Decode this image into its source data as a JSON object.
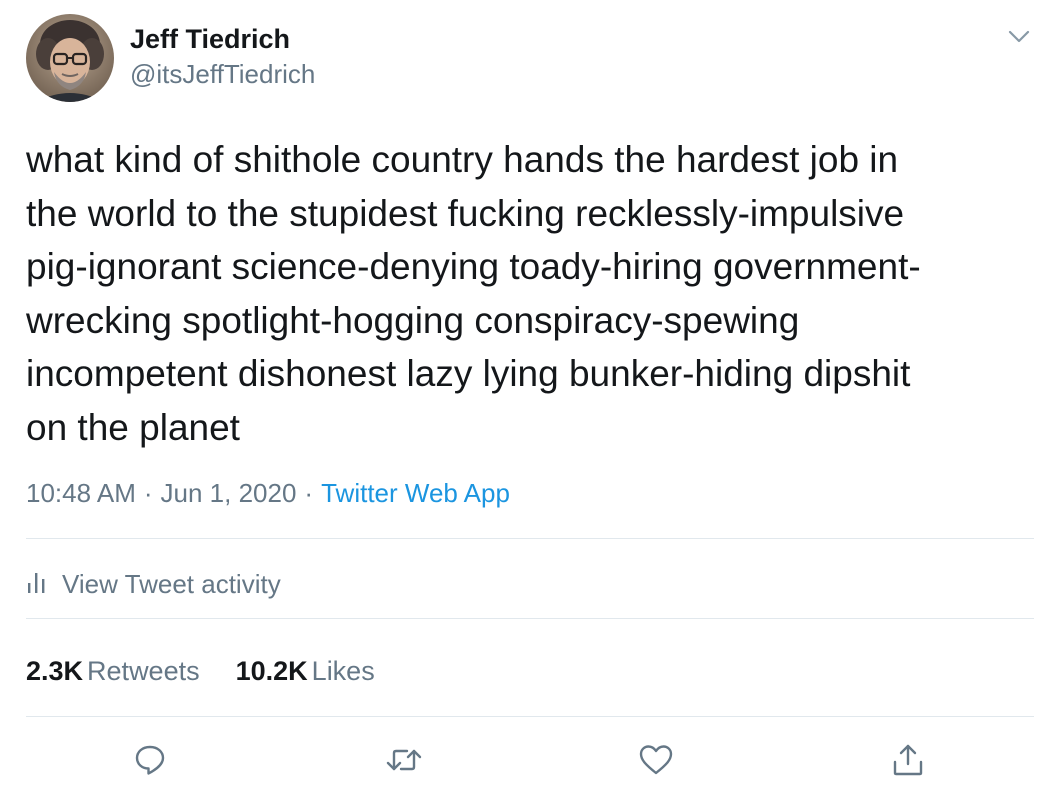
{
  "user": {
    "display_name": "Jeff Tiedrich",
    "handle": "@itsJeffTiedrich"
  },
  "tweet": {
    "text_lines": [
      "what kind of shithole country hands the hardest job in",
      "the world to the stupidest fucking recklessly-impulsive",
      "pig-ignorant science-denying toady-hiring government-",
      "wrecking spotlight-hogging conspiracy-spewing",
      "incompetent dishonest lazy lying bunker-hiding dipshit",
      "on the planet"
    ],
    "time": "10:48 AM",
    "separator": "·",
    "date": "Jun 1, 2020",
    "source": "Twitter Web App"
  },
  "activity": {
    "label": "View Tweet activity",
    "icon": "bar-chart-icon"
  },
  "stats": {
    "retweets_count": "2.3K",
    "retweets_label": "Retweets",
    "likes_count": "10.2K",
    "likes_label": "Likes"
  },
  "actions": [
    {
      "name": "reply",
      "icon": "speech-bubble-icon"
    },
    {
      "name": "retweet",
      "icon": "retweet-arrows-icon"
    },
    {
      "name": "like",
      "icon": "heart-icon"
    },
    {
      "name": "share",
      "icon": "share-upload-icon"
    }
  ],
  "colors": {
    "text_primary": "#14171a",
    "text_secondary": "#657786",
    "link": "#1b95e0",
    "divider": "#e1e8ed"
  }
}
